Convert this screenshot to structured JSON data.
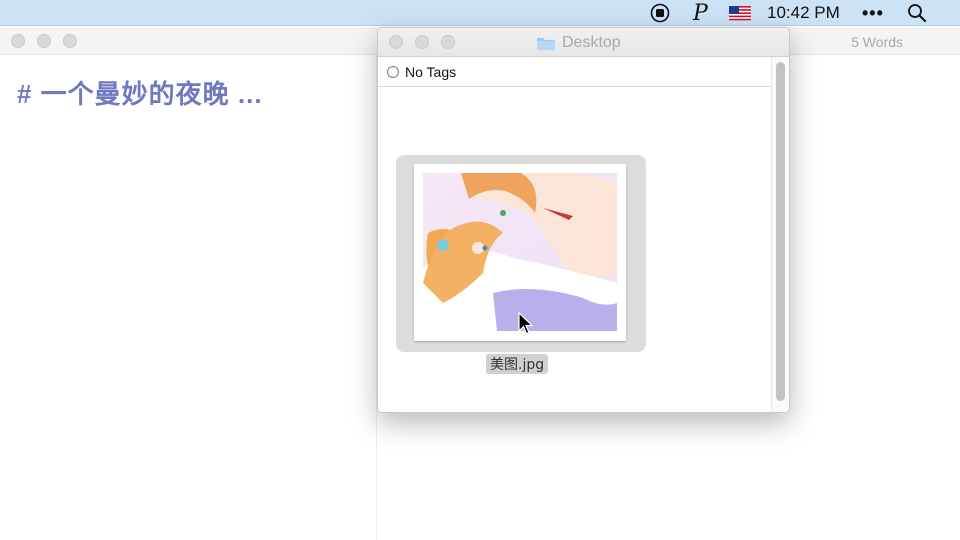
{
  "menubar": {
    "items": {
      "record": "record-stop-icon",
      "p_label": "P",
      "flag": "us-flag-icon",
      "time": "10:42 PM",
      "more": "•••",
      "search": "search-icon"
    },
    "background": "#cce3f7"
  },
  "editor": {
    "word_count": "5 Words",
    "heading": "# 一个曼妙的夜晚 ...",
    "heading_color": "#6f78c0"
  },
  "finder": {
    "title": "Desktop",
    "tag_filter": "No Tags",
    "file": {
      "name": "美图.jpg"
    }
  }
}
